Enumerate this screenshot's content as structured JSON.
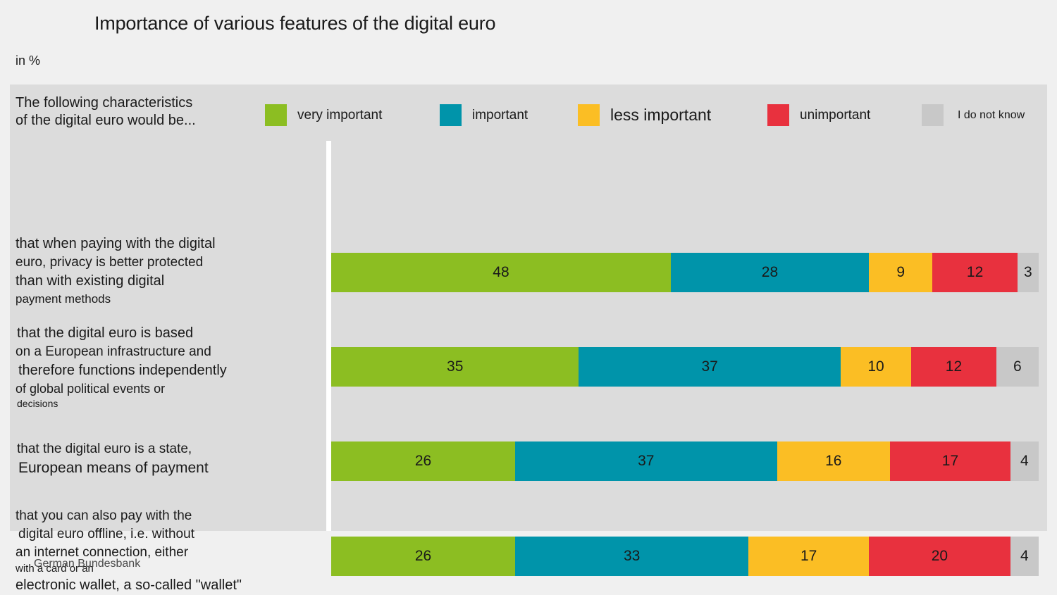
{
  "title": "Importance of various features of the digital euro",
  "subtitle": "in %",
  "footer": "German Bundesbank",
  "legend_intro": "The following characteristics\nof the digital euro would be...",
  "colors": {
    "very_important": "#8CBE22",
    "important": "#0094AA",
    "less_important": "#FBBE24",
    "unimportant": "#E8313E",
    "do_not_know": "#C8C8C8",
    "panel_bg": "#DCDCDC",
    "page_bg": "#F0F0F0",
    "divider": "#FFFFFF"
  },
  "legend": [
    {
      "label": "very important",
      "color": "#8CBE22",
      "key": "very_important"
    },
    {
      "label": "important",
      "color": "#0094AA",
      "key": "important"
    },
    {
      "label": "less important",
      "color": "#FBBE24",
      "key": "less_important"
    },
    {
      "label": "unimportant",
      "color": "#E8313E",
      "key": "unimportant"
    },
    {
      "label": "I do not know",
      "color": "#C8C8C8",
      "key": "do_not_know"
    }
  ],
  "rows": [
    {
      "lines": [
        {
          "text": "that when paying with the digital",
          "size": 20,
          "indent": 0
        },
        {
          "text": "euro, privacy is better protected",
          "size": 19,
          "indent": 0
        },
        {
          "text": "than with existing digital",
          "size": 20,
          "indent": 0
        },
        {
          "text": "payment methods",
          "size": 17,
          "indent": 0
        }
      ],
      "values": [
        48,
        28,
        9,
        12,
        3
      ]
    },
    {
      "lines": [
        {
          "text": "that the digital euro is based",
          "size": 20,
          "indent": 2
        },
        {
          "text": "on a European infrastructure and",
          "size": 19,
          "indent": 0
        },
        {
          "text": "therefore functions independently",
          "size": 20,
          "indent": 4
        },
        {
          "text": "of global political events or",
          "size": 18,
          "indent": 0
        },
        {
          "text": "decisions",
          "size": 14,
          "indent": 2
        }
      ],
      "values": [
        35,
        37,
        10,
        12,
        6
      ]
    },
    {
      "lines": [
        {
          "text": "that the digital euro is a state,",
          "size": 19,
          "indent": 2
        },
        {
          "text": "European means of payment",
          "size": 21,
          "indent": 4
        }
      ],
      "values": [
        26,
        37,
        16,
        17,
        4
      ]
    },
    {
      "lines": [
        {
          "text": "that you can also pay with the",
          "size": 19,
          "indent": 0
        },
        {
          "text": "digital euro offline, i.e. without",
          "size": 19,
          "indent": 4
        },
        {
          "text": "an internet connection, either",
          "size": 19,
          "indent": 0
        },
        {
          "text": "with a card or an",
          "size": 15,
          "indent": 0
        },
        {
          "text": "electronic wallet, a so-called \"wallet\"",
          "size": 20,
          "indent": 0
        }
      ],
      "values": [
        26,
        33,
        17,
        20,
        4
      ]
    }
  ],
  "chart_data": {
    "type": "bar",
    "orientation": "horizontal",
    "stacked": true,
    "stack_total": 100,
    "title": "Importance of various features of the digital euro",
    "subtitle": "in %",
    "xlabel": "",
    "ylabel": "",
    "xlim": [
      0,
      100
    ],
    "grid": false,
    "legend_position": "top",
    "source": "German Bundesbank",
    "categories": [
      "that when paying with the digital euro, privacy is better protected than with existing digital payment methods",
      "that the digital euro is based on a European infrastructure and therefore functions independently of global political events or decisions",
      "that the digital euro is a state, European means of payment",
      "that you can also pay with the digital euro offline, i.e. without an internet connection, either with a card or an electronic wallet, a so-called \"wallet\""
    ],
    "series": [
      {
        "name": "very important",
        "color": "#8CBE22",
        "values": [
          48,
          35,
          26,
          26
        ]
      },
      {
        "name": "important",
        "color": "#0094AA",
        "values": [
          28,
          37,
          37,
          33
        ]
      },
      {
        "name": "less important",
        "color": "#FBBE24",
        "values": [
          9,
          10,
          16,
          17
        ]
      },
      {
        "name": "unimportant",
        "color": "#E8313E",
        "values": [
          12,
          12,
          17,
          20
        ]
      },
      {
        "name": "I do not know",
        "color": "#C8C8C8",
        "values": [
          3,
          6,
          4,
          4
        ]
      }
    ]
  },
  "layout": {
    "row_tops": [
      213,
      340,
      505,
      600
    ],
    "bar_tops": [
      239,
      373,
      507,
      642
    ]
  }
}
